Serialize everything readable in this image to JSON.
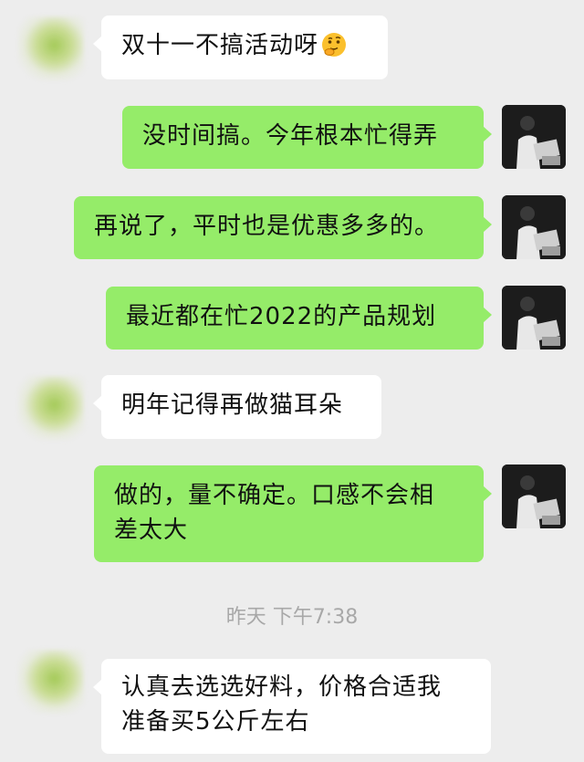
{
  "messages": [
    {
      "text": "双十一不搞活动呀",
      "emoji": "thinking-face-emoji"
    },
    {
      "text": "没时间搞。今年根本忙得弄"
    },
    {
      "text": "再说了，平时也是优惠多多的。"
    },
    {
      "text": "最近都在忙2022的产品规划"
    },
    {
      "text": "明年记得再做猫耳朵"
    },
    {
      "line1": "做的，量不确定。口感不会相",
      "line2": "差太大"
    },
    {
      "line1": "认真去选选好料，价格合适我",
      "line2": "准备买5公斤左右"
    }
  ],
  "timestamp": "昨天 下午7:38",
  "colors": {
    "background": "#ededed",
    "incoming_bubble": "#ffffff",
    "outgoing_bubble": "#95ec69"
  }
}
